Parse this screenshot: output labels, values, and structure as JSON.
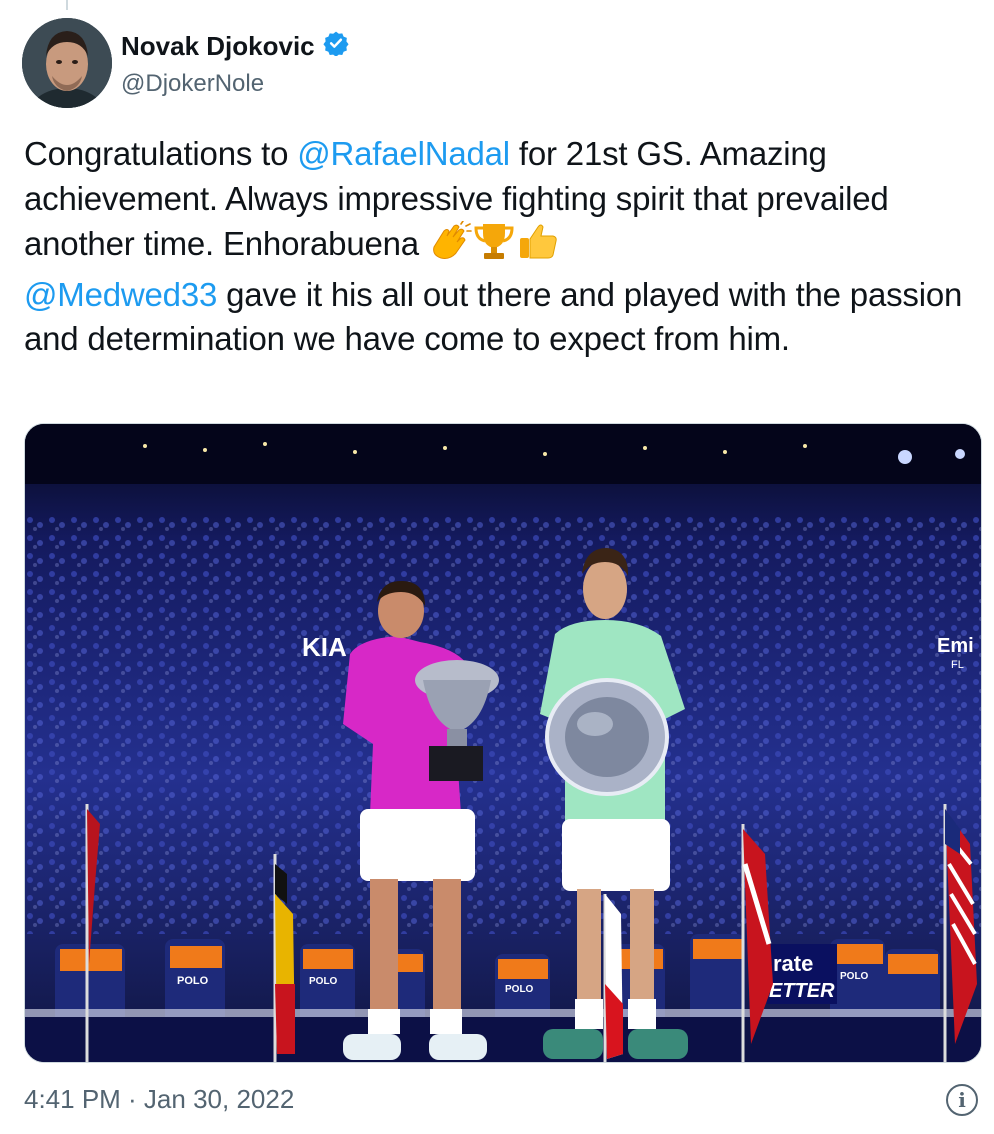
{
  "author": {
    "name": "Novak Djokovic",
    "handle": "@DjokerNole",
    "verified": true,
    "avatar_icon": "profile-photo"
  },
  "tweet": {
    "segments": [
      {
        "type": "text",
        "value": "Congratulations to "
      },
      {
        "type": "mention",
        "value": "@RafaelNadal"
      },
      {
        "type": "text",
        "value": " for 21st GS. Amazing achievement. Always impressive fighting spirit that prevailed another time. Enhorabuena "
      },
      {
        "type": "emoji",
        "value": "clapping-hands"
      },
      {
        "type": "emoji",
        "value": "trophy"
      },
      {
        "type": "emoji",
        "value": "thumbs-up"
      },
      {
        "type": "break"
      },
      {
        "type": "mention",
        "value": "@Medwed33"
      },
      {
        "type": "text",
        "value": " gave it his all out there and played with the passion and determination we have come to expect from him."
      }
    ]
  },
  "media": {
    "alt": "photo",
    "signage": {
      "left_logo": "KIA",
      "right_sign": "Emi",
      "right_sign_sub": "FL",
      "board_text_1": "rate",
      "board_text_2": "ETTER",
      "shirt_text": "POLO"
    }
  },
  "timestamp": "4:41 PM · Jan 30, 2022",
  "colors": {
    "accent": "#1d9bf0",
    "text": "#0f1419",
    "secondary": "#536471"
  }
}
